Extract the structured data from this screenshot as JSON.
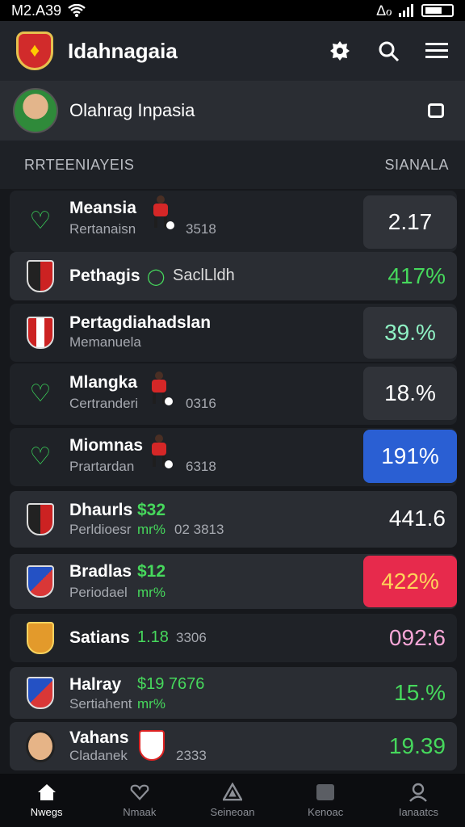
{
  "status_bar": {
    "time": "M2.A39",
    "carrier": "∆ℴ"
  },
  "header": {
    "title": "Idahnagaia",
    "logo_icon": "shield-crest-icon",
    "actions": [
      "settings-icon",
      "search-icon",
      "menu-icon"
    ]
  },
  "profile": {
    "name": "Olahrag Inpasia"
  },
  "section": {
    "left": "RRTEENIAYEIS",
    "right": "SIANALA"
  },
  "rows": [
    {
      "name": "Meansia",
      "sub": "Rertanaisn",
      "extra": "3518",
      "value": "2.17",
      "icon": "heart-icon",
      "badge": "default"
    },
    {
      "name": "Pethagis",
      "sub": "",
      "extra": "SaclLldh",
      "value": "417%",
      "icon": "crest-icon",
      "badge": "plain",
      "value_color": "#46d85c"
    },
    {
      "name": "Pertagdiahadslan",
      "sub": "Memanuela",
      "extra": "",
      "value": "39.%",
      "icon": "crest-icon",
      "badge": "default",
      "value_color": "#8ff2c4"
    },
    {
      "name": "Mlangka",
      "sub": "Certranderi",
      "extra": "0316",
      "value": "18.%",
      "icon": "heart-icon",
      "badge": "default"
    },
    {
      "name": "Miomnas",
      "sub": "Prartardan",
      "extra": "6318",
      "value": "191%",
      "icon": "heart-icon",
      "badge": "blue"
    },
    {
      "name": "Dhaurls",
      "name_extra": "$32",
      "sub": "Perldioesr",
      "sub_extra": "mr%",
      "extra": "02 3813",
      "value": "441.6",
      "icon": "crest-icon",
      "badge": "plain"
    },
    {
      "name": "Bradlas",
      "name_extra": "$12",
      "sub": "Periodael",
      "sub_extra": "mr%",
      "extra": "",
      "value": "422%",
      "icon": "crest-icon",
      "badge": "red",
      "value_color": "#ffd35a"
    },
    {
      "name": "Satians",
      "name_extra": "1.18",
      "sub": "",
      "extra": "3306",
      "value": "092:6",
      "icon": "crest-icon",
      "badge": "plain",
      "value_color": "#f6a6d6"
    },
    {
      "name": "Halray",
      "name_extra": "$19 7676",
      "sub": "Sertiahent",
      "sub_extra": "mr%",
      "extra": "",
      "value": "15.%",
      "icon": "crest-icon",
      "badge": "plain",
      "value_color": "#46d85c"
    },
    {
      "name": "Vahans",
      "sub": "Cladanek",
      "extra": "2333",
      "value": "19.39",
      "icon": "face-icon",
      "badge": "plain",
      "value_color": "#46d85c"
    }
  ],
  "bottom_nav": [
    {
      "label": "Nwegs",
      "icon": "home-icon",
      "active": true
    },
    {
      "label": "Nmaak",
      "icon": "heart-outline-icon",
      "active": false
    },
    {
      "label": "Seineoan",
      "icon": "triangle-icon",
      "active": false
    },
    {
      "label": "Kenoac",
      "icon": "square-icon",
      "active": false
    },
    {
      "label": "Ianaatcs",
      "icon": "user-icon",
      "active": false
    }
  ]
}
